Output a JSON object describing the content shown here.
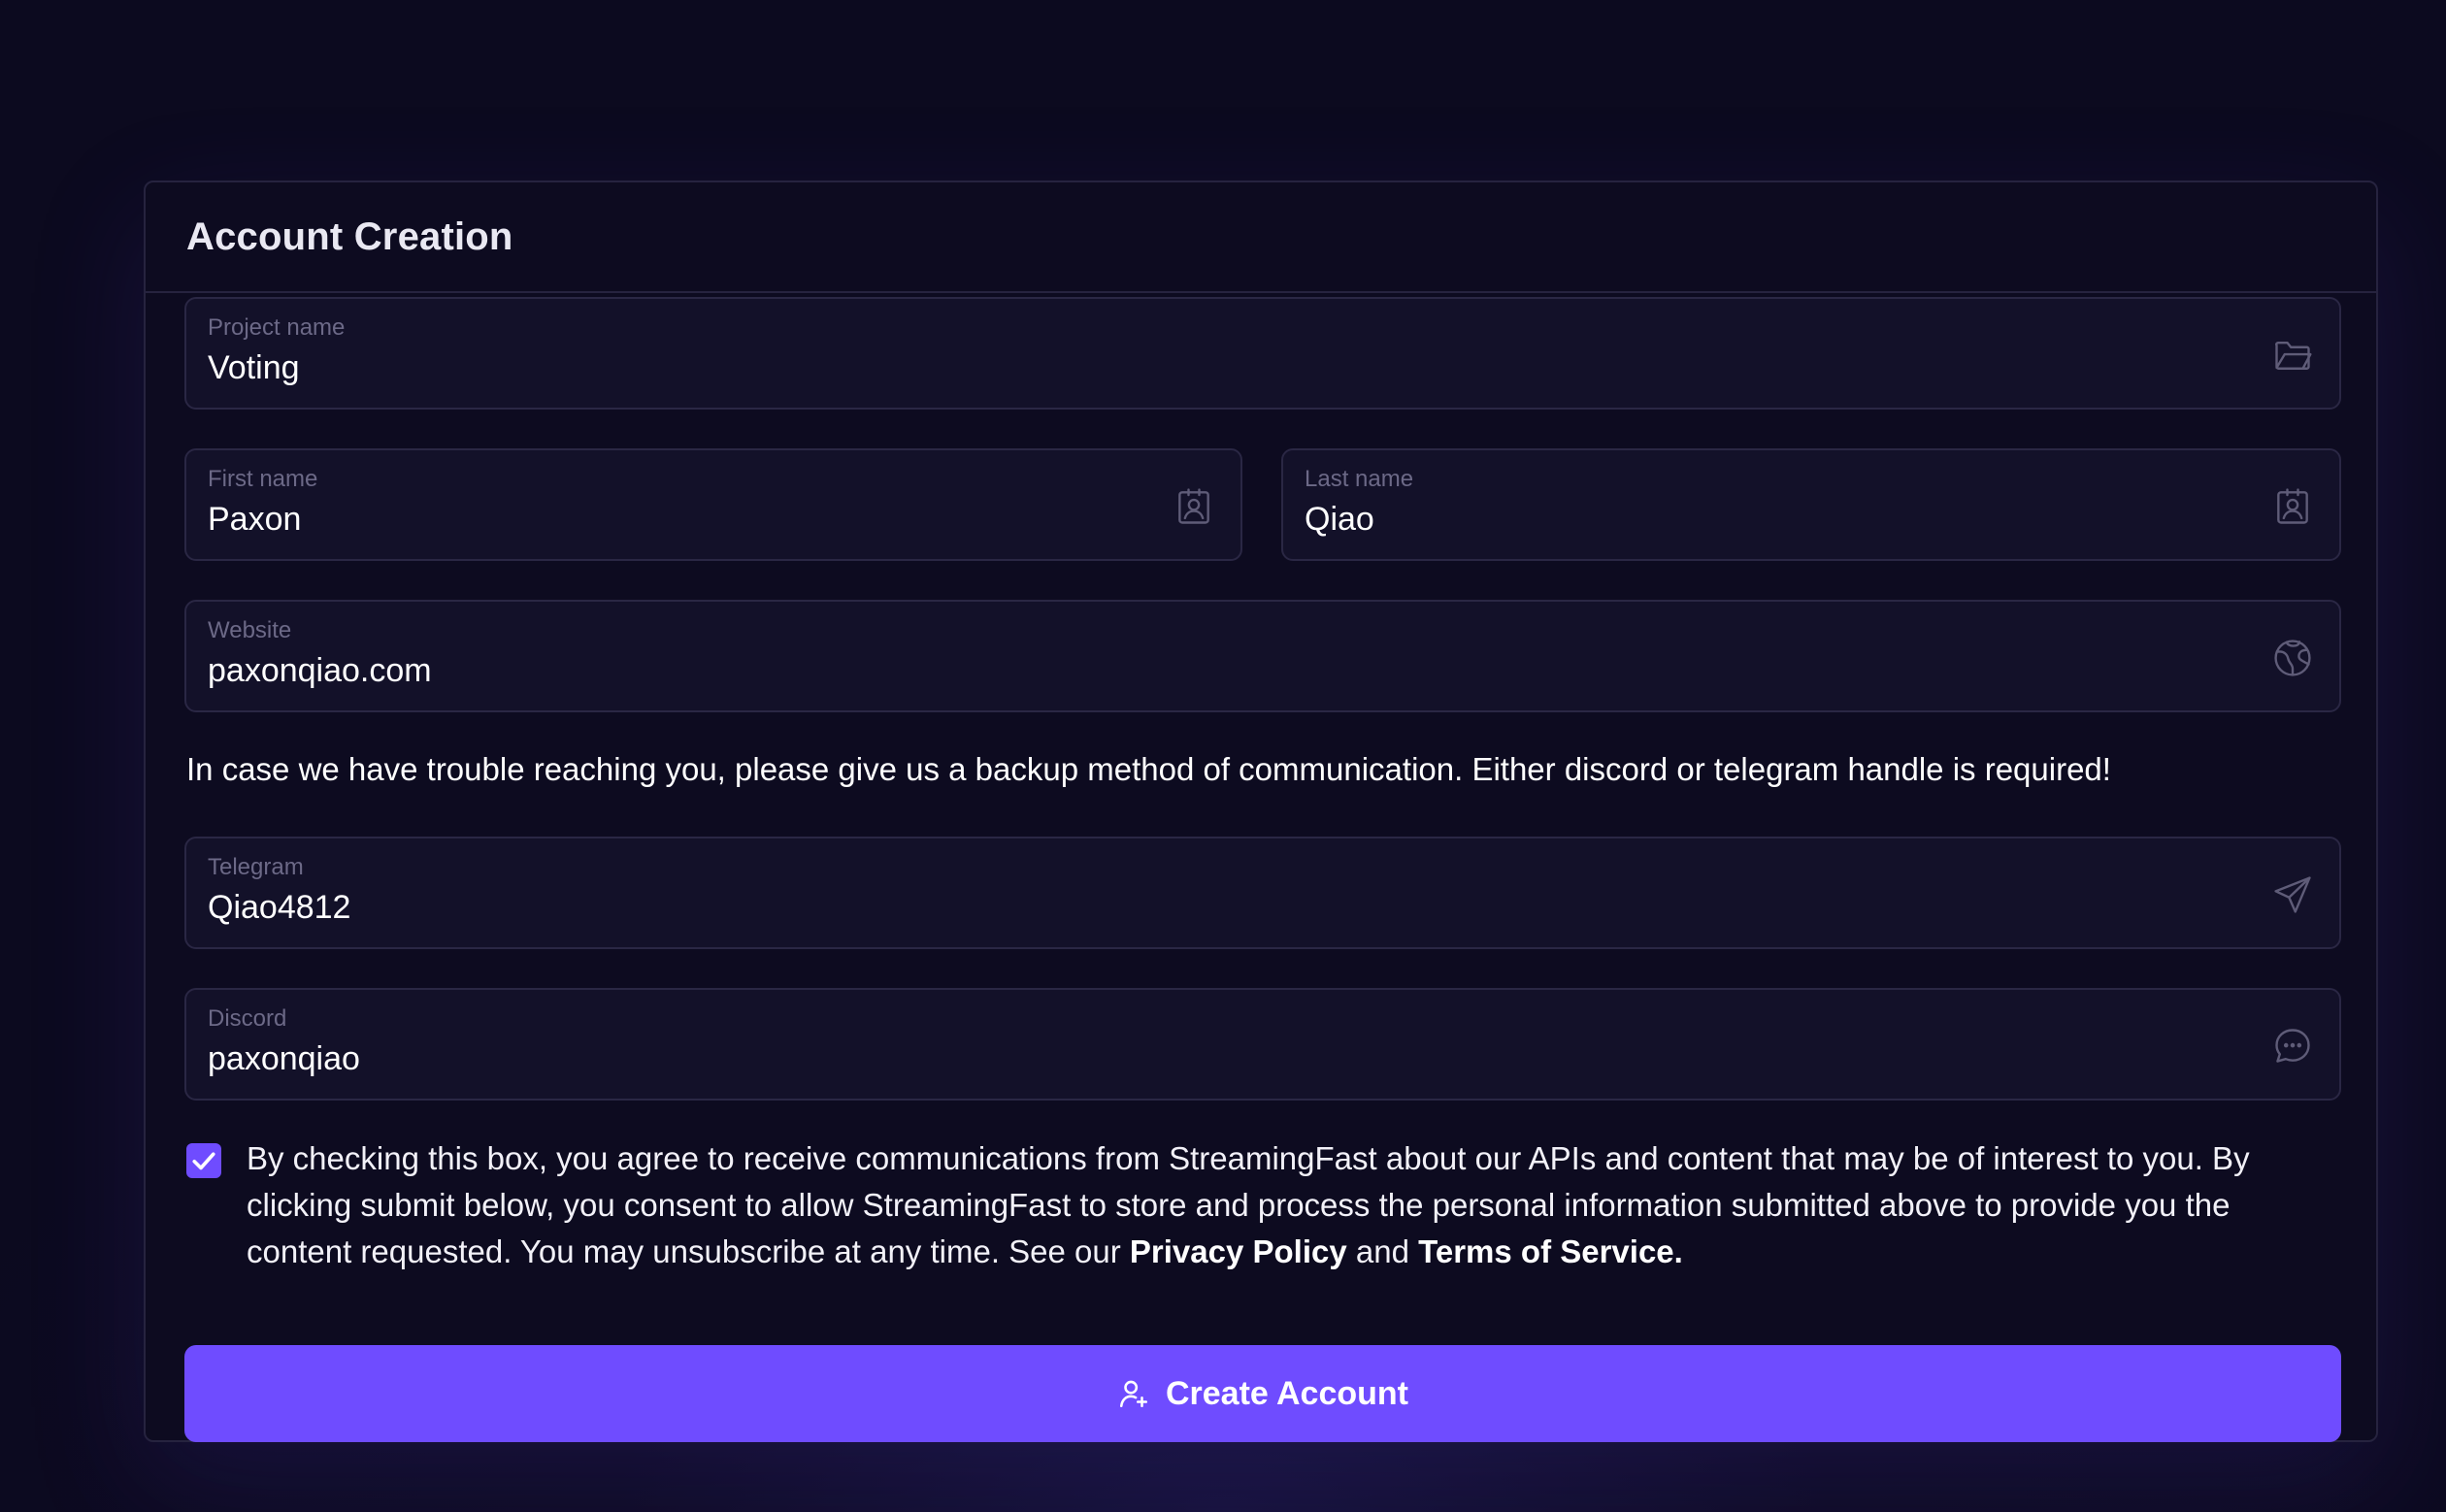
{
  "form": {
    "title": "Account Creation",
    "project_name": {
      "label": "Project name",
      "value": "Voting",
      "icon": "folder-icon"
    },
    "first_name": {
      "label": "First name",
      "value": "Paxon",
      "icon": "contact-badge-icon"
    },
    "last_name": {
      "label": "Last name",
      "value": "Qiao",
      "icon": "contact-badge-icon"
    },
    "website": {
      "label": "Website",
      "value": "paxonqiao.com",
      "icon": "globe-icon"
    },
    "backup_note": "In case we have trouble reaching you, please give us a backup method of communication. Either discord or telegram handle is required!",
    "telegram": {
      "label": "Telegram",
      "value": "Qiao4812",
      "icon": "send-icon"
    },
    "discord": {
      "label": "Discord",
      "value": "paxonqiao",
      "icon": "chat-bubble-icon"
    },
    "consent": {
      "checked": true,
      "text_before": "By checking this box, you agree to receive communications from StreamingFast about our APIs and content that may be of interest to you. By clicking submit below, you consent to allow StreamingFast to store and process the personal information submitted above to provide you the content requested. You may unsubscribe at any time. See our ",
      "privacy_link": "Privacy Policy",
      "and_text": " and ",
      "terms_link": "Terms of Service",
      "period": "."
    },
    "submit": {
      "label": "Create Account",
      "icon": "add-user-icon"
    }
  },
  "colors": {
    "background": "#0c0a1f",
    "card": "#0d0b20",
    "field": "#131129",
    "border": "#2a2744",
    "accent": "#6f4cff",
    "label": "#6c6987"
  }
}
